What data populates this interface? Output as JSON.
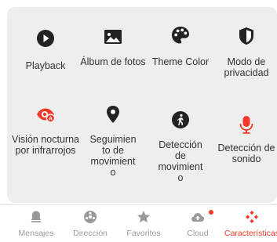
{
  "colors": {
    "accent": "#f23a2b",
    "icon_dark": "#222222",
    "tab_inactive": "#9a9a9a",
    "panel_bg": "#eeeeee"
  },
  "features": [
    {
      "label": "Playback",
      "icon": "play-icon"
    },
    {
      "label": "Álbum de fotos",
      "icon": "photo-icon"
    },
    {
      "label": "Theme Color",
      "icon": "palette-icon"
    },
    {
      "label": "Modo de privacidad",
      "icon": "shield-icon"
    },
    {
      "label": "Visión nocturna por infrarrojos",
      "icon": "night-vision-icon"
    },
    {
      "label": "Seguimiento de movimiento",
      "icon": "location-pin-icon"
    },
    {
      "label": "Detección de movimiento",
      "icon": "walking-person-icon"
    },
    {
      "label": "Detección de sonido",
      "icon": "microphone-icon"
    }
  ],
  "tabs": [
    {
      "label": "Mensajes",
      "icon": "bell-icon",
      "active": false
    },
    {
      "label": "Dirección",
      "icon": "steering-icon",
      "active": false
    },
    {
      "label": "Favoritos",
      "icon": "star-icon",
      "active": false
    },
    {
      "label": "Cloud",
      "icon": "cloud-upload-icon",
      "active": false,
      "badge": true
    },
    {
      "label": "Características",
      "icon": "features-icon",
      "active": true
    }
  ]
}
